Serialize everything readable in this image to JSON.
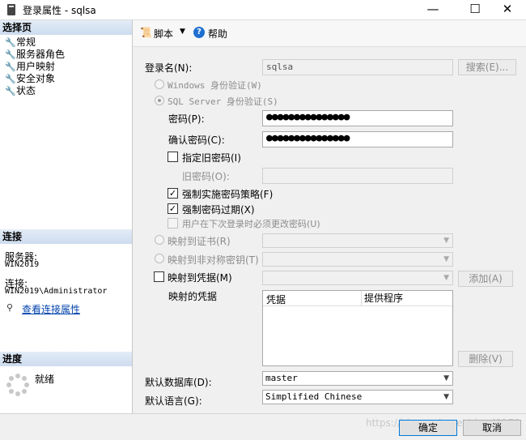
{
  "window": {
    "title": "登录属性 - sqlsa",
    "minimize": "—",
    "maximize": "☐",
    "close": "✕"
  },
  "left": {
    "select_page_header": "选择页",
    "pages": [
      "常规",
      "服务器角色",
      "用户映射",
      "安全对象",
      "状态"
    ],
    "connection_header": "连接",
    "server_label": "服务器:",
    "server_value": "WIN2019",
    "conn_label": "连接:",
    "conn_value": "WIN2019\\Administrator",
    "view_conn_props": "查看连接属性",
    "progress_header": "进度",
    "progress_status": "就绪"
  },
  "toolbar": {
    "script_label": "脚本",
    "help_label": "帮助"
  },
  "form": {
    "login_name_label": "登录名(N):",
    "login_name_value": "sqlsa",
    "search_button": "搜索(E)...",
    "windows_auth": "Windows 身份验证(W)",
    "sql_auth": "SQL Server 身份验证(S)",
    "password_label": "密码(P):",
    "password_value": "●●●●●●●●●●●●●●●",
    "confirm_label": "确认密码(C):",
    "confirm_value": "●●●●●●●●●●●●●●●",
    "specify_old": "指定旧密码(I)",
    "old_password_label": "旧密码(O):",
    "enforce_policy": "强制实施密码策略(F)",
    "enforce_expiration": "强制密码过期(X)",
    "must_change": "用户在下次登录时必须更改密码(U)",
    "map_cert": "映射到证书(R)",
    "map_asym": "映射到非对称密钥(T)",
    "map_cred": "映射到凭据(M)",
    "add_button": "添加(A)",
    "mapped_creds_label": "映射的凭据",
    "grid_col_cred": "凭据",
    "grid_col_provider": "提供程序",
    "remove_button": "删除(V)",
    "default_db_label": "默认数据库(D):",
    "default_db_value": "master",
    "default_lang_label": "默认语言(G):",
    "default_lang_value": "Simplified Chinese"
  },
  "buttons": {
    "ok": "确定",
    "cancel": "取消"
  },
  "watermark": "https://blog.csdn.net/shuyi0170"
}
